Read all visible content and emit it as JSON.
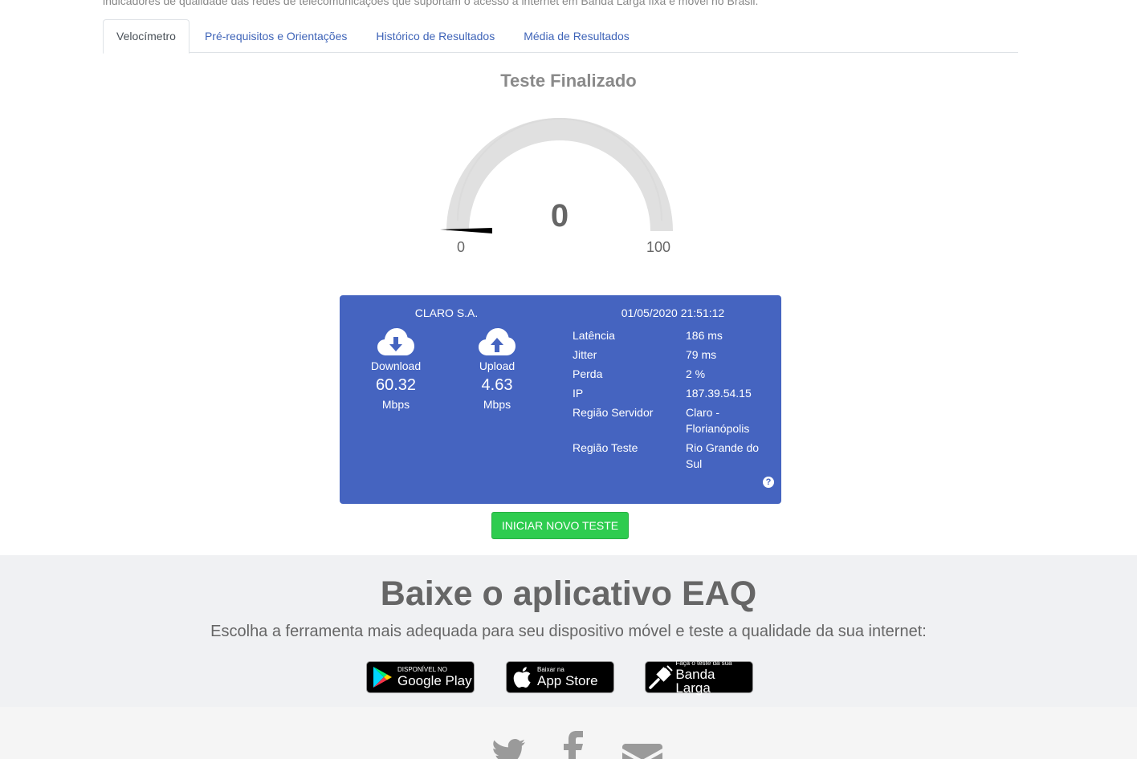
{
  "intro_text": "indicadores de qualidade das redes de telecomunicações que suportam o acesso à internet em Banda Larga fixa e móvel no Brasil.",
  "tabs": [
    {
      "label": "Velocímetro",
      "active": true
    },
    {
      "label": "Pré-requisitos e Orientações",
      "active": false
    },
    {
      "label": "Histórico de Resultados",
      "active": false
    },
    {
      "label": "Média de Resultados",
      "active": false
    }
  ],
  "status_title": "Teste Finalizado",
  "gauge": {
    "value": "0",
    "min_label": "0",
    "max_label": "100",
    "level_fraction": 0
  },
  "result": {
    "isp": "CLARO S.A.",
    "datetime": "01/05/2020 21:51:12",
    "download": {
      "label": "Download",
      "value": "60.32",
      "unit": "Mbps",
      "icon": "cloud-download-icon"
    },
    "upload": {
      "label": "Upload",
      "value": "4.63",
      "unit": "Mbps",
      "icon": "cloud-upload-icon"
    },
    "details": [
      {
        "key": "Latência",
        "value": "186 ms"
      },
      {
        "key": "Jitter",
        "value": "79 ms"
      },
      {
        "key": "Perda",
        "value": "2 %"
      },
      {
        "key": "IP",
        "value": "187.39.54.15"
      },
      {
        "key": "Região Servidor",
        "value": "Claro - Florianópolis"
      },
      {
        "key": "Região Teste",
        "value": "Rio Grande do Sul"
      }
    ],
    "help_icon": "question-circle-icon"
  },
  "new_test_button": "INICIAR NOVO TESTE",
  "app": {
    "title": "Baixe o aplicativo EAQ",
    "subtitle": "Escolha a ferramenta mais adequada para seu dispositivo móvel e teste a qualidade da sua internet:",
    "stores": [
      {
        "small": "DISPONÍVEL NO",
        "big": "Google Play",
        "icon": "google-play-icon"
      },
      {
        "small": "Baixar na",
        "big": "App Store",
        "icon": "apple-icon"
      },
      {
        "small": "Faça o teste da sua",
        "big": "Banda Larga",
        "icon": "ethernet-plug-icon"
      }
    ]
  },
  "colors": {
    "accent": "#4564c0",
    "button": "#2ecc4f",
    "link": "#3f64b8"
  },
  "footer_icons": [
    "twitter-icon",
    "facebook-icon",
    "envelope-icon"
  ]
}
